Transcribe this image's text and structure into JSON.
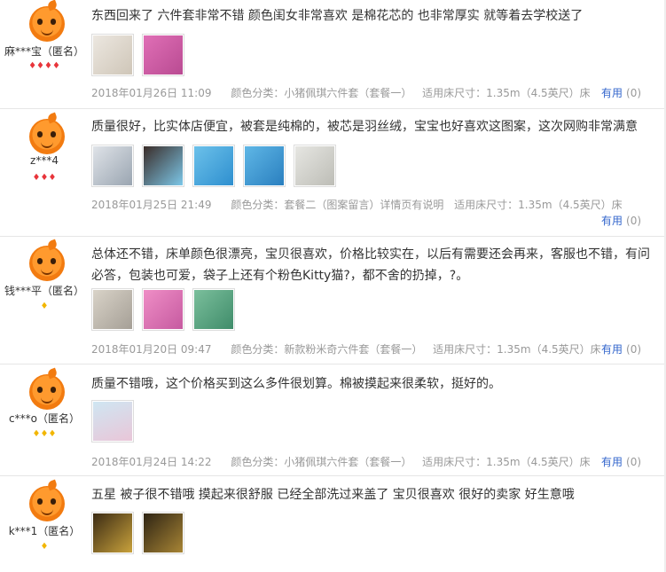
{
  "reviews": [
    {
      "username": "麻***宝（匿名）",
      "rank": "hearts-4",
      "rank_symbols": "♦♦♦♦",
      "content": "东西回来了 六件套非常不错 颜色闺女非常喜欢 是棉花芯的 也非常厚实 就等着去学校送了",
      "date": "2018年01月26日 11:09",
      "color": "颜色分类：小猪佩琪六件套（套餐一）",
      "size": "适用床尺寸：1.35m（4.5英尺）床",
      "useful_label": "有用",
      "useful_count": "(0)",
      "thumbs": [
        [
          "#ece7e0",
          "#cfc6b8"
        ],
        [
          "#e06fb6",
          "#b94b92"
        ]
      ]
    },
    {
      "username": "z***4",
      "rank": "hearts-3",
      "rank_symbols": "♦♦♦",
      "content": "质量很好，比实体店便宜，被套是纯棉的，被芯是羽丝绒，宝宝也好喜欢这图案，这次网购非常满意",
      "date": "2018年01月25日 21:49",
      "color": "颜色分类：套餐二（图案留言）详情页有说明",
      "size": "适用床尺寸：1.35m（4.5英尺）床",
      "useful_label": "有用",
      "useful_count": "(0)",
      "thumbs": [
        [
          "#dfe3e8",
          "#9aa5b1"
        ],
        [
          "#3a2c28",
          "#7cc7e8"
        ],
        [
          "#6cc1ea",
          "#2e8fcf"
        ],
        [
          "#5fb7e6",
          "#2a7fbf"
        ],
        [
          "#e6e6e2",
          "#bdbdb6"
        ]
      ]
    },
    {
      "username": "钱***平（匿名）",
      "rank": "crown-1",
      "rank_symbols": "♦",
      "content": "总体还不错，床单颜色很漂亮，宝贝很喜欢，价格比较实在，以后有需要还会再来，客服也不错，有问必答，包装也可爱，袋子上还有个粉色Kitty猫?，都不舍的扔掉，?。",
      "date": "2018年01月20日 09:47",
      "color": "颜色分类：新款粉米奇六件套（套餐一）",
      "size": "适用床尺寸：1.35m（4.5英尺）床",
      "useful_label": "有用",
      "useful_count": "(0)",
      "thumbs": [
        [
          "#d9d3c8",
          "#a59f96"
        ],
        [
          "#ef8ec6",
          "#c65aa0"
        ],
        [
          "#7bbf9c",
          "#3f8c6a"
        ]
      ]
    },
    {
      "username": "c***o（匿名）",
      "rank": "crown-3",
      "rank_symbols": "♦♦♦",
      "content": "质量不错哦，这个价格买到这么多件很划算。棉被摸起来很柔软，挺好的。",
      "date": "2018年01月24日 14:22",
      "color": "颜色分类：小猪佩琪六件套（套餐一）",
      "size": "适用床尺寸：1.35m（4.5英尺）床",
      "useful_label": "有用",
      "useful_count": "(0)",
      "thumbs": [
        [
          "#cfe6f2",
          "#e9c6d8"
        ]
      ]
    },
    {
      "username": "k***1（匿名）",
      "rank": "crown-1",
      "rank_symbols": "♦",
      "content": "五星 被子很不错哦 摸起来很舒服 已经全部洗过来盖了 宝贝很喜欢 很好的卖家 好生意哦",
      "date": "",
      "color": "",
      "size": "",
      "useful_label": "",
      "useful_count": "",
      "thumbs": [
        [
          "#3b2b14",
          "#c9a23c"
        ],
        [
          "#2e2414",
          "#a88535"
        ]
      ]
    }
  ],
  "colors": {
    "accent_link": "#3366cc",
    "meta_text": "#999999",
    "divider": "#e6e6e6",
    "heart": "#e8353b",
    "crown": "#f2b600",
    "avatar": "#ff9a2e"
  }
}
